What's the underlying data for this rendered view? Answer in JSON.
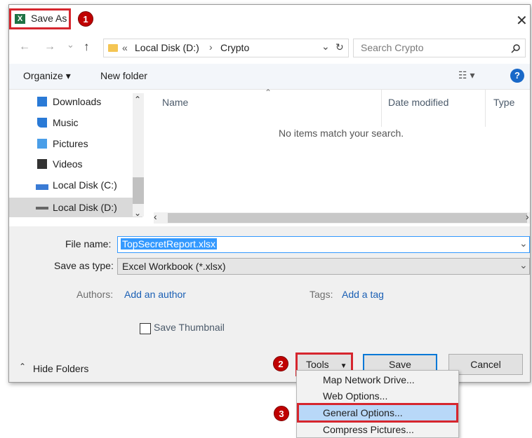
{
  "window": {
    "title": "Save As",
    "close_glyph": "✕"
  },
  "badges": [
    "1",
    "2",
    "3"
  ],
  "nav": {
    "back": "←",
    "forward": "→",
    "recent": "⌄",
    "up": "↑",
    "breadcrumb_overflow": "«",
    "path": [
      "Local Disk (D:)",
      "Crypto"
    ],
    "separator": "›",
    "dropdown": "⌄",
    "refresh": "↻",
    "search_placeholder": "Search Crypto"
  },
  "toolbar": {
    "organize": "Organize ▾",
    "new_folder": "New folder",
    "view": "☷ ▾",
    "help": "?"
  },
  "sidebar": {
    "items": [
      {
        "label": "Downloads",
        "icon": "downloads-icon",
        "color": "#2a7ad6"
      },
      {
        "label": "Music",
        "icon": "music-icon",
        "color": "#2a7ad6"
      },
      {
        "label": "Pictures",
        "icon": "pictures-icon",
        "color": "#4a9ee8"
      },
      {
        "label": "Videos",
        "icon": "videos-icon",
        "color": "#333333"
      },
      {
        "label": "Local Disk (C:)",
        "icon": "drive-icon",
        "color": "#3a7bd5"
      },
      {
        "label": "Local Disk (D:)",
        "icon": "drive-icon",
        "color": "#555555"
      }
    ],
    "scroll_up": "⌃",
    "scroll_down": "⌄"
  },
  "file_list": {
    "columns": [
      "Name",
      "Date modified",
      "Type"
    ],
    "sort_glyph": "⌃",
    "empty_message": "No items match your search.",
    "hscroll_left": "‹",
    "hscroll_right": "›"
  },
  "form": {
    "file_name_label": "File name:",
    "file_name_value": "TopSecretReport.xlsx",
    "save_type_label": "Save as type:",
    "save_type_value": "Excel Workbook (*.xlsx)",
    "authors_label": "Authors:",
    "authors_value": "Add an author",
    "tags_label": "Tags:",
    "tags_value": "Add a tag",
    "thumbnail_label": "Save Thumbnail",
    "dropdown_glyph": "⌄"
  },
  "footer": {
    "hide_folders": "Hide Folders",
    "hide_glyph": "⌃",
    "tools": "Tools",
    "tools_arrow": "▼",
    "save": "Save",
    "cancel": "Cancel"
  },
  "tools_menu": {
    "items": [
      "Map Network Drive...",
      "Web Options...",
      "General Options...",
      "Compress Pictures..."
    ],
    "highlighted_index": 2
  },
  "colors": {
    "annotation_red": "#d6262e",
    "selection_blue": "#3399ff",
    "link_blue": "#1a5fb4"
  }
}
